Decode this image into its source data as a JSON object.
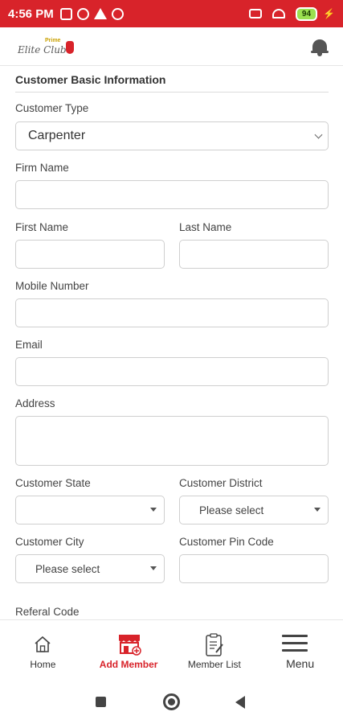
{
  "status_bar": {
    "time": "4:56 PM",
    "battery": "94"
  },
  "header": {
    "logo_text": "Elite Club",
    "logo_top": "Prime"
  },
  "form": {
    "section_title": "Customer Basic Information",
    "customer_type_label": "Customer Type",
    "customer_type_value": "Carpenter",
    "firm_name_label": "Firm Name",
    "first_name_label": "First Name",
    "last_name_label": "Last Name",
    "mobile_label": "Mobile Number",
    "email_label": "Email",
    "address_label": "Address",
    "state_label": "Customer State",
    "district_label": "Customer District",
    "district_placeholder": "Please select",
    "city_label": "Customer City",
    "city_placeholder": "Please select",
    "pin_label": "Customer Pin Code",
    "referral_label": "Referal Code"
  },
  "bottom_nav": {
    "home": "Home",
    "add_member": "Add Member",
    "member_list": "Member List",
    "menu": "Menu"
  },
  "colors": {
    "accent": "#d8232a",
    "text": "#333333",
    "border": "#cfcfcf"
  }
}
